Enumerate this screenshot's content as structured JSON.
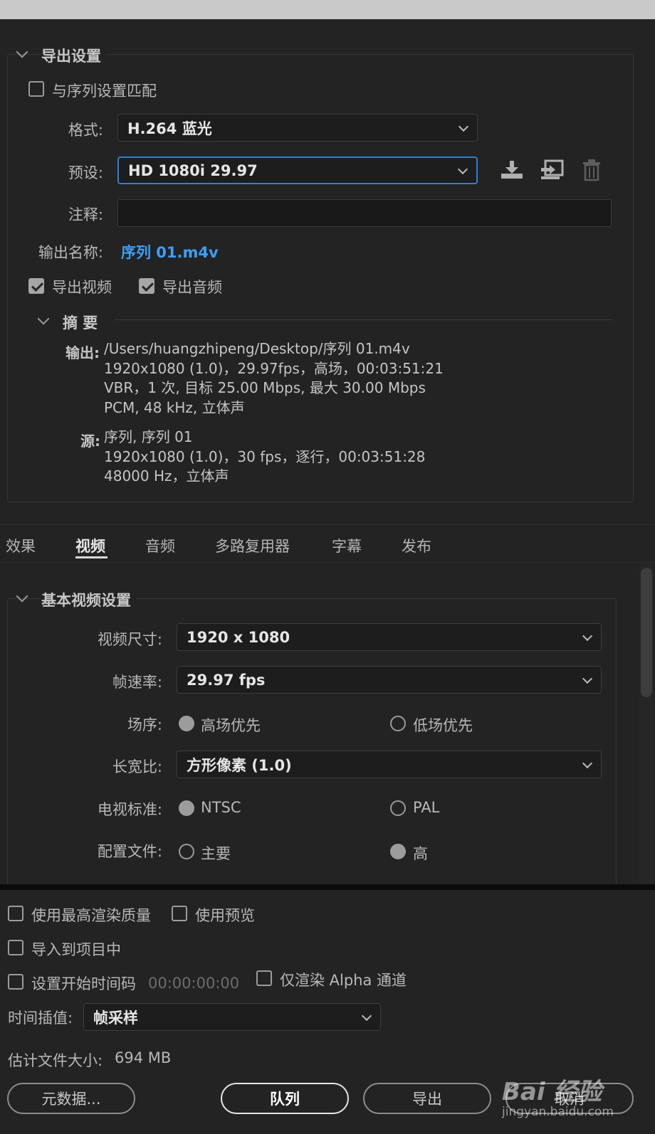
{
  "export_settings": {
    "header": "导出设置",
    "match_sequence_label": "与序列设置匹配",
    "format_label": "格式:",
    "format_value": "H.264 蓝光",
    "preset_label": "预设:",
    "preset_value": "HD 1080i 29.97",
    "comment_label": "注释:",
    "comment_value": "",
    "output_name_label": "输出名称:",
    "output_name_value": "序列 01.m4v",
    "export_video_label": "导出视频",
    "export_audio_label": "导出音频"
  },
  "summary": {
    "header": "摘 要",
    "output_key": "输出:",
    "output_lines": [
      "/Users/huangzhipeng/Desktop/序列 01.m4v",
      "1920x1080 (1.0)，29.97fps，高场，00:03:51:21",
      "VBR，1 次, 目标 25.00 Mbps, 最大 30.00 Mbps",
      "PCM, 48  kHz, 立体声"
    ],
    "source_key": "源:",
    "source_lines": [
      "序列, 序列 01",
      "1920x1080 (1.0)，30 fps，逐行，00:03:51:28",
      "48000 Hz，立体声"
    ]
  },
  "tabs": [
    "效果",
    "视频",
    "音频",
    "多路复用器",
    "字幕",
    "发布"
  ],
  "video_settings": {
    "header": "基本视频设置",
    "size_label": "视频尺寸:",
    "size_value": "1920 x 1080",
    "fps_label": "帧速率:",
    "fps_value": "29.97 fps",
    "field_label": "场序:",
    "field_upper": "高场优先",
    "field_lower": "低场优先",
    "aspect_label": "长宽比:",
    "aspect_value": "方形像素 (1.0)",
    "tv_label": "电视标准:",
    "tv_ntsc": "NTSC",
    "tv_pal": "PAL",
    "profile_label": "配置文件:",
    "profile_main": "主要",
    "profile_high": "高"
  },
  "bottom": {
    "max_quality": "使用最高渲染质量",
    "use_preview": "使用预览",
    "import_project": "导入到项目中",
    "set_timecode": "设置开始时间码",
    "timecode_value": "00:00:00:00",
    "alpha_only": "仅渲染 Alpha 通道",
    "interp_label": "时间插值:",
    "interp_value": "帧采样",
    "filesize_label": "估计文件大小:",
    "filesize_value": "694 MB",
    "metadata_btn": "元数据...",
    "queue_btn": "队列",
    "export_btn": "导出",
    "cancel_btn": "取消"
  },
  "watermark": {
    "brand": "Bai 经验",
    "url": "jingyan.baidu.com"
  }
}
